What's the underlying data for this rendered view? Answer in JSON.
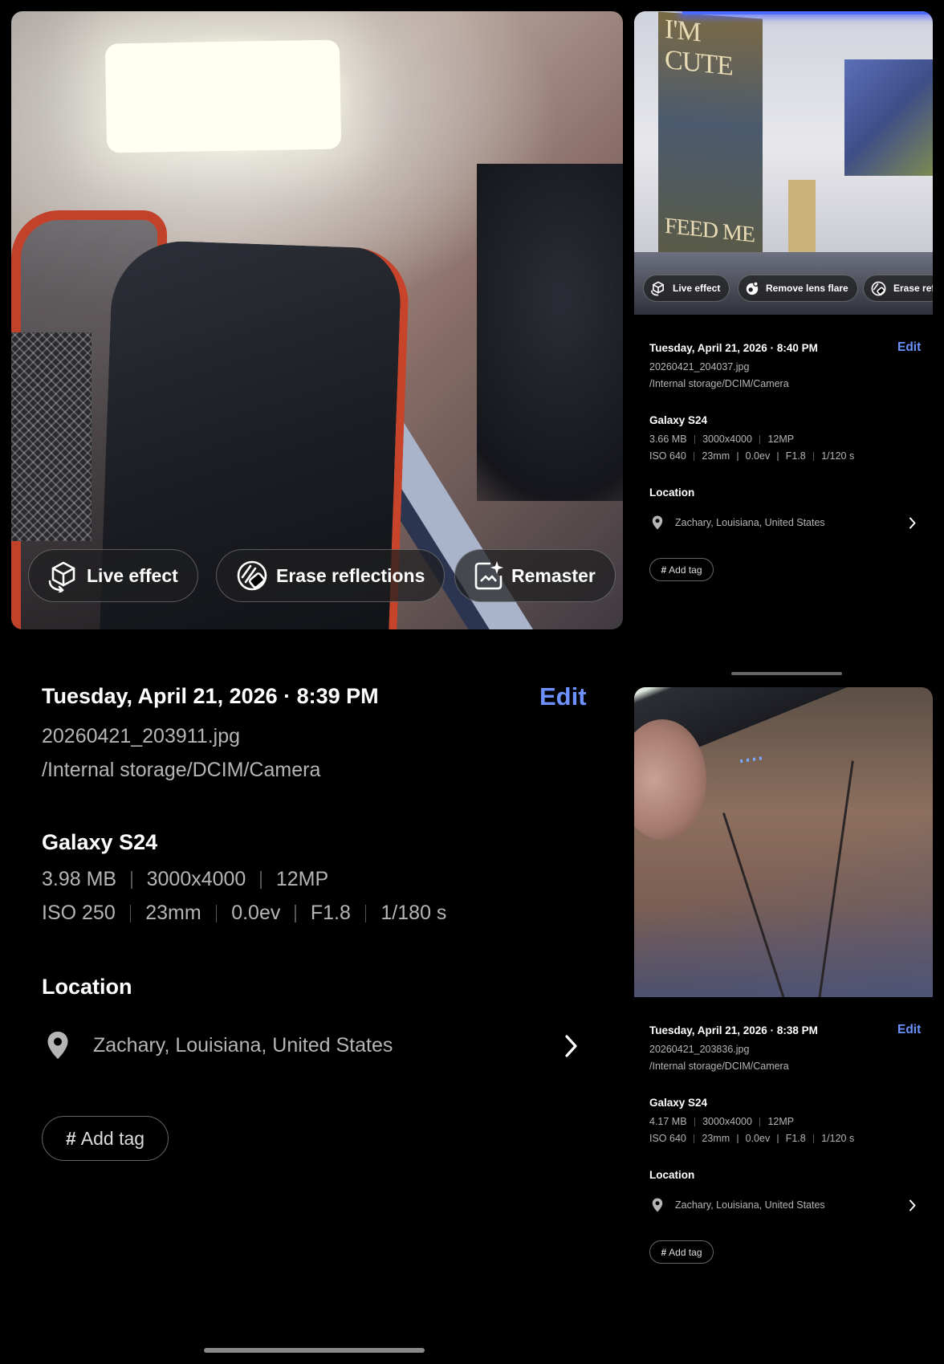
{
  "main": {
    "actions": [
      {
        "label": "Live effect",
        "icon": "live-effect-icon"
      },
      {
        "label": "Erase reflections",
        "icon": "erase-reflections-icon"
      },
      {
        "label": "Remaster",
        "icon": "remaster-icon"
      }
    ],
    "info": {
      "date": "Tuesday, April 21, 2026 · 8:39 PM",
      "edit_label": "Edit",
      "filename": "20260421_203911.jpg",
      "path": "/Internal storage/DCIM/Camera",
      "device": "Galaxy S24",
      "specs_line1": [
        "3.98 MB",
        "3000x4000",
        "12MP"
      ],
      "specs_line2": [
        "ISO 250",
        "23mm",
        "0.0ev",
        "F1.8",
        "1/180 s"
      ],
      "location_title": "Location",
      "location": "Zachary, Louisiana, United States",
      "add_tag_label": "Add tag"
    }
  },
  "top_right": {
    "actions": [
      {
        "label": "Live effect",
        "icon": "live-effect-icon"
      },
      {
        "label": "Remove lens flare",
        "icon": "remove-lens-flare-icon"
      },
      {
        "label": "Erase ref",
        "icon": "erase-reflections-icon"
      }
    ],
    "poster_text_top": "I'M CUTE",
    "poster_text_bottom": "FEED ME",
    "info": {
      "date": "Tuesday, April 21, 2026 · 8:40 PM",
      "edit_label": "Edit",
      "filename": "20260421_204037.jpg",
      "path": "/Internal storage/DCIM/Camera",
      "device": "Galaxy S24",
      "specs_line1": [
        "3.66 MB",
        "3000x4000",
        "12MP"
      ],
      "specs_line2": [
        "ISO 640",
        "23mm",
        "0.0ev",
        "F1.8",
        "1/120 s"
      ],
      "location_title": "Location",
      "location": "Zachary, Louisiana, United States",
      "add_tag_label": "Add tag"
    }
  },
  "bottom_right": {
    "info": {
      "date": "Tuesday, April 21, 2026 · 8:38 PM",
      "edit_label": "Edit",
      "filename": "20260421_203836.jpg",
      "path": "/Internal storage/DCIM/Camera",
      "device": "Galaxy S24",
      "specs_line1": [
        "4.17 MB",
        "3000x4000",
        "12MP"
      ],
      "specs_line2": [
        "ISO 640",
        "23mm",
        "0.0ev",
        "F1.8",
        "1/120 s"
      ],
      "location_title": "Location",
      "location": "Zachary, Louisiana, United States",
      "add_tag_label": "Add tag"
    }
  },
  "colors": {
    "accent": "#6d91ff",
    "background": "#000000",
    "muted_text": "#b5b5b5"
  }
}
